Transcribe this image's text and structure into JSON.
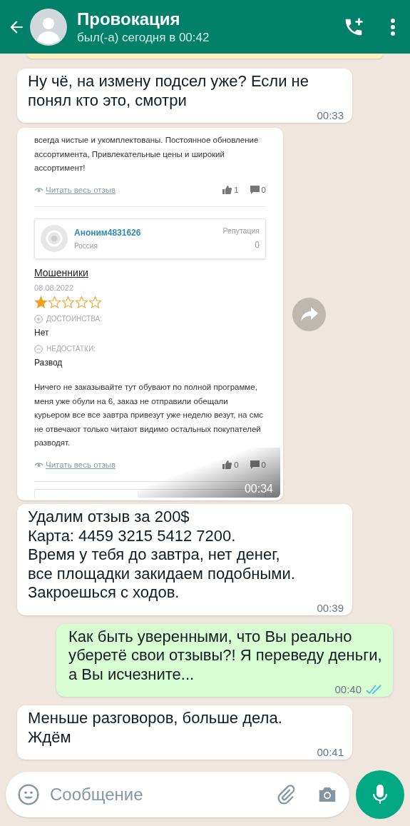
{
  "header": {
    "title": "Провокация",
    "status": "был(-а) сегодня в 00:42"
  },
  "messages": [
    {
      "kind": "text",
      "outgoing": false,
      "text": "Ну чё, на измену подсел уже? Если не понял кто это, смотри",
      "time": "00:33"
    },
    {
      "kind": "screenshot",
      "outgoing": false,
      "time": "00:34",
      "review": {
        "snippet": "всегда чистые и укомплектованы. Постоянное обновление ассортимента, Привлекательные цены и широкий ассортимент!",
        "snippet_footer": {
          "link": "Читать весь отзыв",
          "likes": "1",
          "comments": "0"
        },
        "author": {
          "name": "Аноним4831626",
          "country": "Россия",
          "reputation_label": "Репутация",
          "reputation": "0"
        },
        "title": "Мошенники",
        "date": "08.08.2022",
        "stars": 1,
        "pros_label": "ДОСТОИНСТВА:",
        "pros": "Нет",
        "cons_label": "НЕДОСТАТКИ:",
        "cons": "Развод",
        "body": "Ничего не заказывайте тут обувают по полной программе, меня уже обули на 6, заказ не отправили обещали курьером все все завтра привезут уже неделю везут, на смс не отвечают только читают видимо остальных покупателей разводят.",
        "footer": {
          "link": "Читать весь отзыв",
          "likes": "0",
          "comments": "0"
        }
      }
    },
    {
      "kind": "text",
      "outgoing": false,
      "text": "Удалим отзыв за 200$\nКарта: 4459 3215 5412 7200.\nВремя у тебя до завтра, нет денег,\nвсе площадки закидаем подобными.\nЗакроешься с ходов.",
      "time": "00:39"
    },
    {
      "kind": "text",
      "outgoing": true,
      "text": "Как быть уверенными, что Вы реально уберетё свои отзывы?! Я переведу деньги, а Вы исчезните...",
      "time": "00:40",
      "read": true
    },
    {
      "kind": "text",
      "outgoing": false,
      "text": "Меньше разговоров, больше дела.\nЖдём",
      "time": "00:41"
    }
  ],
  "composer": {
    "placeholder": "Сообщение"
  }
}
